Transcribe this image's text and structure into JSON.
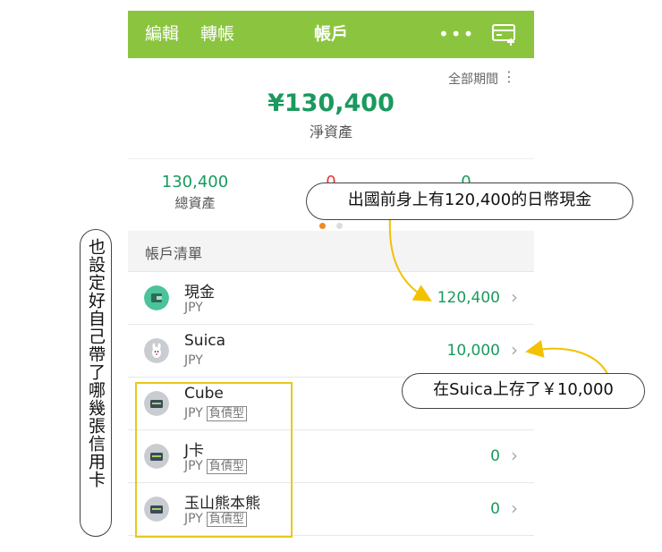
{
  "header": {
    "edit_label": "編輯",
    "transfer_label": "轉帳",
    "title": "帳戶",
    "more_label": "•••"
  },
  "summary": {
    "period_label": "全部期間",
    "net_worth": "¥130,400",
    "net_worth_label": "淨資產",
    "total_assets": "130,400",
    "total_assets_label": "總資產",
    "liabilities": "0",
    "other": "0"
  },
  "account_list": {
    "section_title": "帳戶清單",
    "accounts": [
      {
        "name": "現金",
        "currency": "JPY",
        "tag": "",
        "amount": "120,400",
        "icon": "wallet-icon"
      },
      {
        "name": "Suica",
        "currency": "JPY",
        "tag": "",
        "amount": "10,000",
        "icon": "suica-icon"
      },
      {
        "name": "Cube",
        "currency": "JPY",
        "tag": "負債型",
        "amount": "0",
        "icon": "credit-card-icon"
      },
      {
        "name": "J卡",
        "currency": "JPY",
        "tag": "負債型",
        "amount": "0",
        "icon": "credit-card-icon"
      },
      {
        "name": "玉山熊本熊",
        "currency": "JPY",
        "tag": "負債型",
        "amount": "0",
        "icon": "credit-card-icon"
      }
    ]
  },
  "annotations": {
    "cash_note": "出國前身上有120,400的日幣現金",
    "suica_note": "在Suica上存了￥10,000",
    "cards_note": "也設定好自己帶了哪幾張信用卡"
  },
  "colors": {
    "header_bg": "#8bc53f",
    "positive_amount": "#1a9a5e",
    "negative_amount": "#e53935",
    "highlight_box": "#e8c81a",
    "arrow": "#f2c200",
    "page_dot_active": "#f08a24"
  }
}
